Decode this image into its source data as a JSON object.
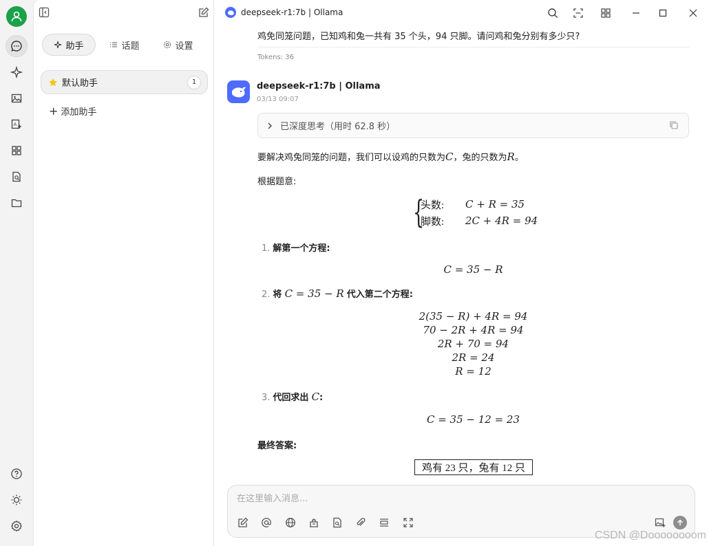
{
  "window": {
    "title": "deepseek-r1:7b | Ollama"
  },
  "sidebar_tabs": [
    {
      "label": "助手",
      "icon": "sparkle-icon"
    },
    {
      "label": "话题",
      "icon": "list-icon"
    },
    {
      "label": "设置",
      "icon": "gear-icon"
    }
  ],
  "assistants": [
    {
      "name": "默认助手",
      "count": "1",
      "icon": "star-icon"
    }
  ],
  "add_assistant_label": "添加助手",
  "user_message": "鸡免同笼问题，已知鸡和兔一共有 35 个头，94 只脚。请问鸡和兔分别有多少只?",
  "tokens_label": "Tokens: 36",
  "bot": {
    "name": "deepseek-r1:7b | Ollama",
    "time": "03/13 09:07"
  },
  "thinking_label": "已深度思考（用时 62.8 秒）",
  "answer": {
    "intro_pre": "要解决鸡兔同笼的问题，我们可以设鸡的只数为",
    "var_c": "C",
    "intro_mid": "，兔的只数为",
    "var_r": "R",
    "intro_end": "。",
    "by_problem": "根据题意:",
    "system_rows": [
      {
        "label": "头数:",
        "eq": "C + R = 35"
      },
      {
        "label": "脚数:",
        "eq": "2C + 4R = 94"
      }
    ],
    "step1_num": "1.",
    "step1_label": "解第一个方程:",
    "step1_eq": "C = 35 − R",
    "step2_num": "2.",
    "step2_pre": "将",
    "step2_math": "C = 35 − R",
    "step2_post": "代入第二个方程:",
    "step2_eqs": [
      "2(35 − R) + 4R = 94",
      "70 − 2R + 4R = 94",
      "2R + 70 = 94",
      "2R = 24",
      "R = 12"
    ],
    "step3_num": "3.",
    "step3_label": "代回求出",
    "step3_var": "C",
    "step3_colon": ":",
    "step3_eq": "C = 35 − 12 = 23",
    "final_label": "最终答案:",
    "final_answer": "鸡有 23 只，兔有 12 只"
  },
  "input": {
    "placeholder": "在这里输入消息..."
  },
  "watermark": "CSDN @Doooooooom",
  "colors": {
    "accent": "#1aa14a",
    "model_blue": "#4d6bfe"
  }
}
